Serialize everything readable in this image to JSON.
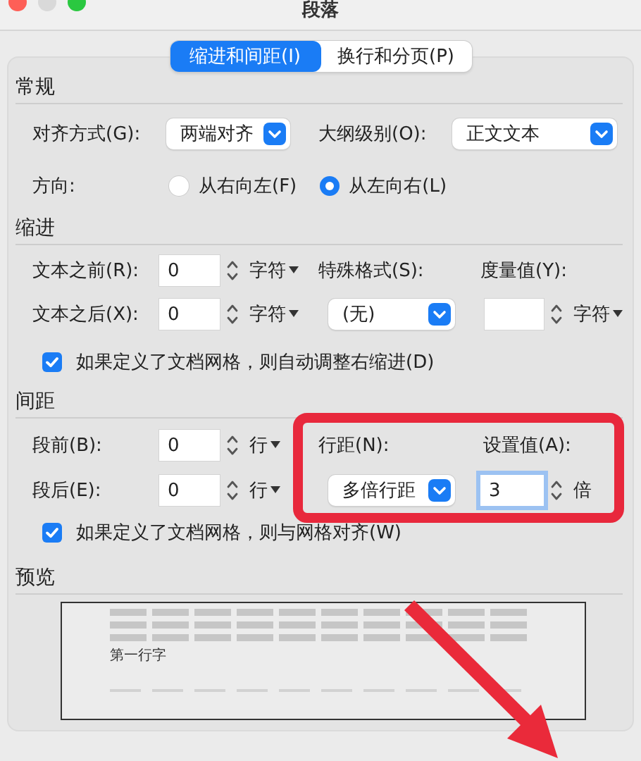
{
  "window": {
    "title": "段落"
  },
  "tabs": [
    {
      "label": "缩进和间距(I)",
      "selected": true
    },
    {
      "label": "换行和分页(P)",
      "selected": false
    }
  ],
  "general": {
    "heading": "常规",
    "alignment": {
      "label": "对齐方式(G):",
      "value": "两端对齐"
    },
    "outline_level": {
      "label": "大纲级别(O):",
      "value": "正文文本"
    },
    "direction": {
      "label": "方向:",
      "options": [
        {
          "label": "从右向左(F)",
          "selected": false
        },
        {
          "label": "从左向右(L)",
          "selected": true
        }
      ]
    }
  },
  "indent": {
    "heading": "缩进",
    "before": {
      "label": "文本之前(R):",
      "value": "0",
      "unit": "字符",
      "unit_menu": true
    },
    "after": {
      "label": "文本之后(X):",
      "value": "0",
      "unit": "字符",
      "unit_menu": true
    },
    "special": {
      "label": "特殊格式(S):",
      "value": "(无)"
    },
    "by": {
      "label": "度量值(Y):",
      "unit": "字符",
      "unit_menu": true
    },
    "auto_adjust": {
      "label": "如果定义了文档网格，则自动调整右缩进(D)",
      "checked": true
    }
  },
  "spacing": {
    "heading": "间距",
    "before": {
      "label": "段前(B):",
      "value": "0",
      "unit": "行",
      "unit_menu": true
    },
    "after": {
      "label": "段后(E):",
      "value": "0",
      "unit": "行",
      "unit_menu": true
    },
    "line_spacing": {
      "label": "行距(N):",
      "value": "多倍行距"
    },
    "at": {
      "label": "设置值(A):",
      "value": "3",
      "unit": "倍",
      "unit_menu": false,
      "focused": true
    },
    "snap_to_grid": {
      "label": "如果定义了文档网格，则与网格对齐(W)",
      "checked": true
    }
  },
  "preview": {
    "heading": "预览",
    "first_line": "第一行字"
  }
}
